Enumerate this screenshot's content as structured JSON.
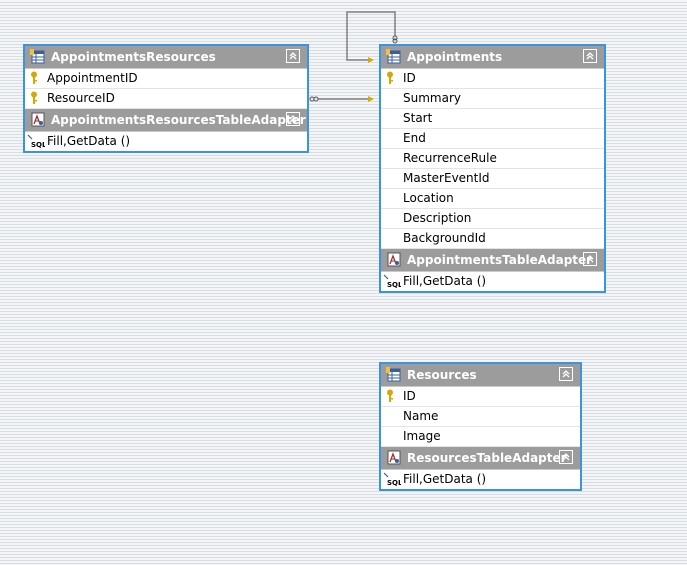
{
  "tables": {
    "appointments_resources": {
      "title": "AppointmentsResources",
      "columns": [
        "AppointmentID",
        "ResourceID"
      ],
      "adapter_title": "AppointmentsResourcesTableAdapter",
      "adapter_method": "Fill,GetData ()"
    },
    "appointments": {
      "title": "Appointments",
      "columns": [
        "ID",
        "Summary",
        "Start",
        "End",
        "RecurrenceRule",
        "MasterEventId",
        "Location",
        "Description",
        "BackgroundId"
      ],
      "adapter_title": "AppointmentsTableAdapter",
      "adapter_method": "Fill,GetData ()"
    },
    "resources": {
      "title": "Resources",
      "columns": [
        "ID",
        "Name",
        "Image"
      ],
      "adapter_title": "ResourcesTableAdapter",
      "adapter_method": "Fill,GetData ()"
    }
  },
  "colors": {
    "selection_border": "#3b93e4",
    "header_bg": "#9c9c9c",
    "relation_line": "#808080",
    "key_icon": "#d8a800"
  },
  "icons": {
    "table": "table-icon",
    "adapter": "table-adapter-icon",
    "sql": "sql-query-icon",
    "key": "primary-key-icon",
    "collapse": "collapse-chevron-icon"
  }
}
